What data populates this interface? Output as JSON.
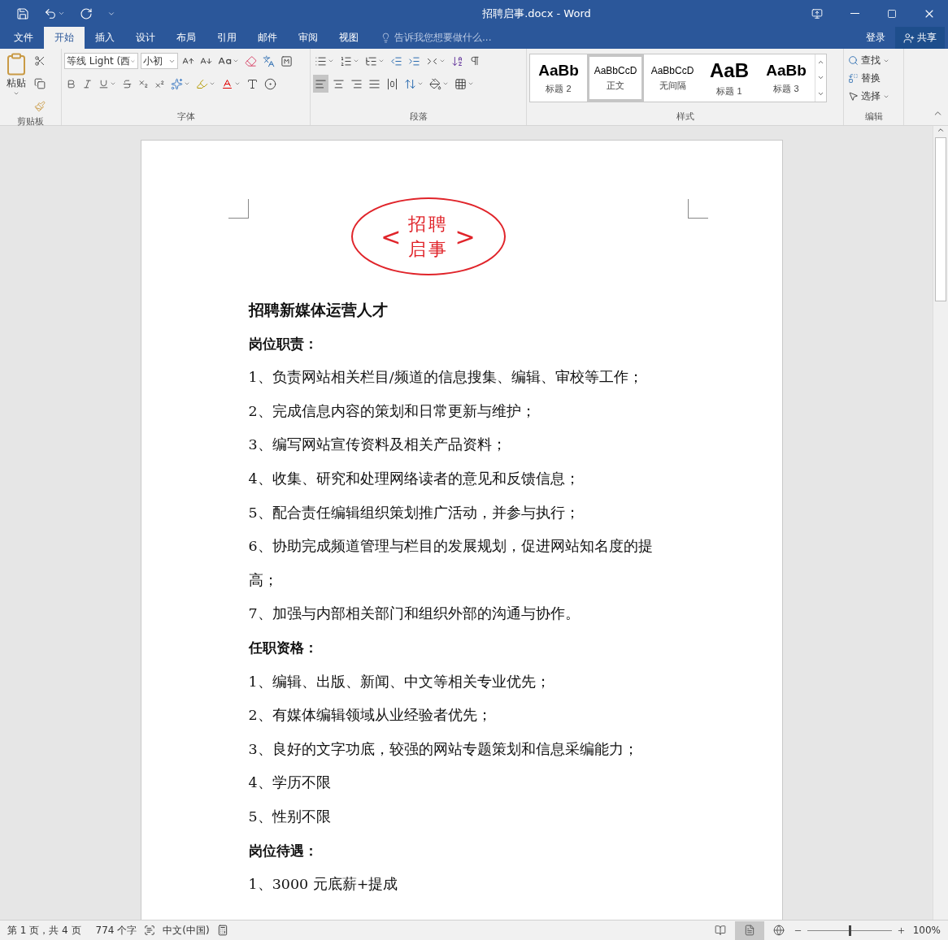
{
  "window": {
    "title": "招聘启事.docx - Word"
  },
  "tabs": [
    {
      "label": "文件",
      "selected": false
    },
    {
      "label": "开始",
      "selected": true
    },
    {
      "label": "插入",
      "selected": false
    },
    {
      "label": "设计",
      "selected": false
    },
    {
      "label": "布局",
      "selected": false
    },
    {
      "label": "引用",
      "selected": false
    },
    {
      "label": "邮件",
      "selected": false
    },
    {
      "label": "审阅",
      "selected": false
    },
    {
      "label": "视图",
      "selected": false
    }
  ],
  "tell_me": {
    "placeholder": "告诉我您想要做什么..."
  },
  "account": {
    "sign_in": "登录",
    "share": "共享"
  },
  "ribbon": {
    "clipboard": {
      "paste": "粘贴",
      "label": "剪贴板"
    },
    "font": {
      "name": "等线 Light (西",
      "size": "小初",
      "label": "字体"
    },
    "paragraph": {
      "label": "段落",
      "align": [
        {
          "selected": true
        },
        {
          "selected": false
        },
        {
          "selected": false
        },
        {
          "selected": false
        },
        {
          "selected": false
        }
      ]
    },
    "styles": {
      "label": "样式",
      "items": [
        {
          "preview": "AaBb",
          "name": "标题 2",
          "selected": false,
          "kind": "heading2"
        },
        {
          "preview": "AaBbCcD",
          "name": "正文",
          "selected": true,
          "kind": "normal"
        },
        {
          "preview": "AaBbCcD",
          "name": "无间隔",
          "selected": false,
          "kind": "normal"
        },
        {
          "preview": "AaB",
          "name": "标题 1",
          "selected": false,
          "kind": "heading1"
        },
        {
          "preview": "AaBb",
          "name": "标题 3",
          "selected": false,
          "kind": "heading3"
        }
      ]
    },
    "editing": {
      "label": "编辑",
      "find": "查找",
      "replace": "替换",
      "select": "选择"
    }
  },
  "document": {
    "stamp": {
      "left": "<",
      "lines": [
        "招聘",
        "启事"
      ],
      "right": ">"
    },
    "blocks": [
      {
        "kind": "title",
        "text": "招聘新媒体运营人才"
      },
      {
        "kind": "heading",
        "text": "岗位职责："
      },
      {
        "kind": "item",
        "text": "1、负责网站相关栏目/频道的信息搜集、编辑、审校等工作；"
      },
      {
        "kind": "item",
        "text": "2、完成信息内容的策划和日常更新与维护；"
      },
      {
        "kind": "item",
        "text": "3、编写网站宣传资料及相关产品资料；"
      },
      {
        "kind": "item",
        "text": "4、收集、研究和处理网络读者的意见和反馈信息；"
      },
      {
        "kind": "item",
        "text": "5、配合责任编辑组织策划推广活动，并参与执行；"
      },
      {
        "kind": "item",
        "text": "6、协助完成频道管理与栏目的发展规划，促进网站知名度的提高；"
      },
      {
        "kind": "item",
        "text": "7、加强与内部相关部门和组织外部的沟通与协作。"
      },
      {
        "kind": "heading",
        "text": "任职资格："
      },
      {
        "kind": "item",
        "text": "1、编辑、出版、新闻、中文等相关专业优先；"
      },
      {
        "kind": "item",
        "text": "2、有媒体编辑领域从业经验者优先；"
      },
      {
        "kind": "item",
        "text": "3、良好的文字功底，较强的网站专题策划和信息采编能力；"
      },
      {
        "kind": "item",
        "text": "4、学历不限"
      },
      {
        "kind": "item",
        "text": "5、性别不限"
      },
      {
        "kind": "heading",
        "text": "岗位待遇："
      },
      {
        "kind": "item",
        "text": "1、3000 元底薪+提成"
      }
    ]
  },
  "status_bar": {
    "page": "第 1 页，共 4 页",
    "words": "774 个字",
    "language": "中文(中国)",
    "views": [
      {
        "selected": false
      },
      {
        "selected": true
      },
      {
        "selected": false
      }
    ],
    "zoom": {
      "level": 0.5,
      "reading": "100%"
    }
  }
}
